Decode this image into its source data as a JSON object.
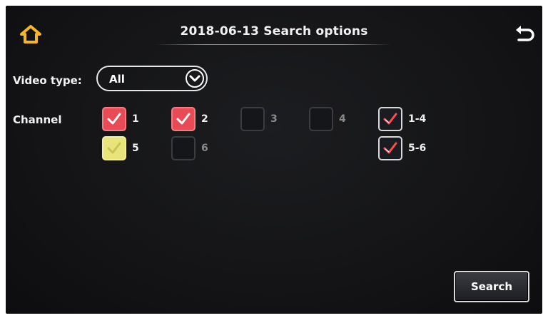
{
  "header": {
    "title": "2018-06-13  Search options",
    "home_icon": "home-icon",
    "back_icon": "back-arrow-icon",
    "icon_color": "#f5b623"
  },
  "video_type": {
    "label": "Video type:",
    "value": "All"
  },
  "channel": {
    "label": "Channel",
    "checkboxes": [
      {
        "label": "1",
        "checked": true,
        "style": "red"
      },
      {
        "label": "2",
        "checked": true,
        "style": "red"
      },
      {
        "label": "3",
        "checked": false
      },
      {
        "label": "4",
        "checked": false
      },
      {
        "label": "1-4",
        "checked": true,
        "style": "dark"
      },
      {
        "label": "5",
        "checked": true,
        "style": "yellow"
      },
      {
        "label": "6",
        "checked": false
      },
      {
        "label": "5-6",
        "checked": true,
        "style": "dark"
      }
    ]
  },
  "actions": {
    "search_label": "Search"
  },
  "colors": {
    "red_check": "#e84b55",
    "yellow_check": "#e9e47a",
    "background": "#141416"
  }
}
